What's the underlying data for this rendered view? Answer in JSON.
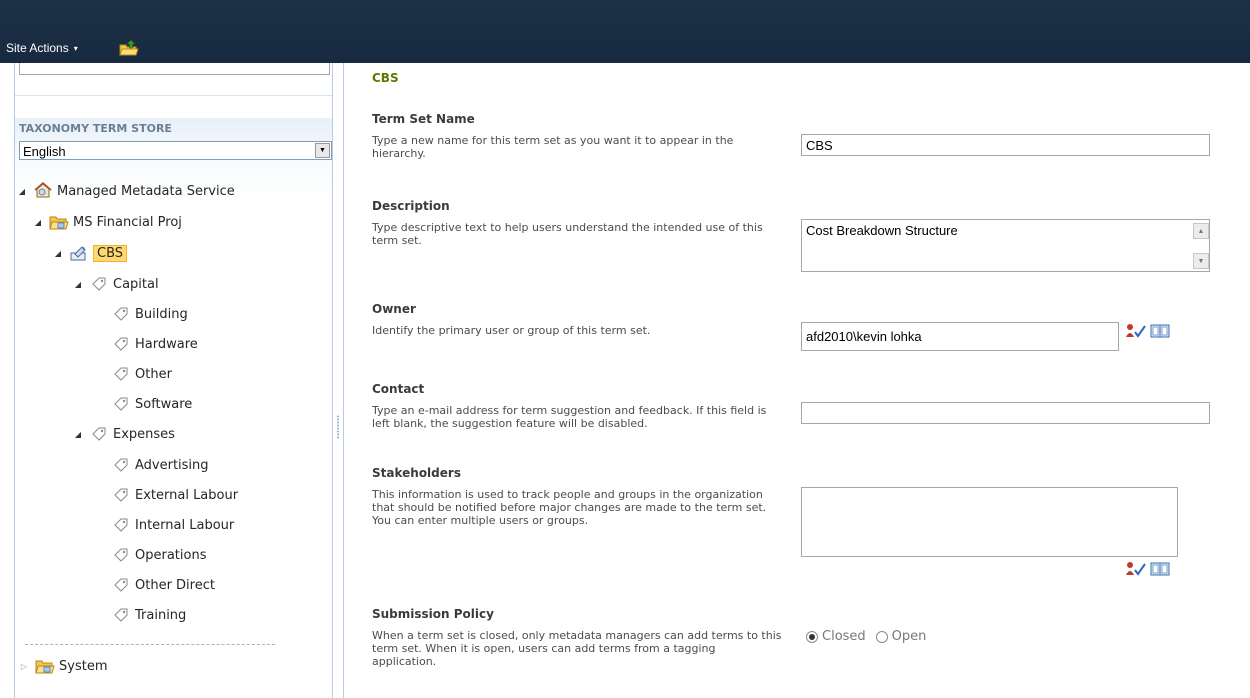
{
  "ribbon": {
    "site_actions_label": "Site Actions",
    "caret": "▾",
    "colors": {
      "background": "#1c3046",
      "text": "#ffffff"
    }
  },
  "left_pane": {
    "store_title": "TAXONOMY TERM STORE",
    "language": "English",
    "tree": {
      "root": "Managed Metadata Service",
      "group": "MS Financial Proj",
      "term_set": "CBS",
      "capital": "Capital",
      "capital_terms": [
        "Building",
        "Hardware",
        "Other",
        "Software"
      ],
      "expenses": "Expenses",
      "expense_terms": [
        "Advertising",
        "External Labour",
        "Internal Labour",
        "Operations",
        "Other Direct",
        "Training"
      ],
      "system": "System"
    },
    "selected_color": "#ffd96e"
  },
  "form": {
    "heading": "CBS",
    "term_set_name": {
      "title": "Term Set Name",
      "desc": "Type a new name for this term set as you want it to appear in the hierarchy.",
      "value": "CBS"
    },
    "description": {
      "title": "Description",
      "desc": "Type descriptive text to help users understand the intended use of this term set.",
      "value": "Cost Breakdown Structure"
    },
    "owner": {
      "title": "Owner",
      "desc": "Identify the primary user or group of this term set.",
      "value": "afd2010\\kevin lohka"
    },
    "contact": {
      "title": "Contact",
      "desc": "Type an e-mail address for term suggestion and feedback. If this field is left blank, the suggestion feature will be disabled.",
      "value": ""
    },
    "stakeholders": {
      "title": "Stakeholders",
      "desc": "This information is used to track people and groups in the organization that should be notified before major changes are made to the term set. You can enter multiple users or groups.",
      "value": ""
    },
    "submission_policy": {
      "title": "Submission Policy",
      "desc": "When a term set is closed, only metadata managers can add terms to this term set. When it is open, users can add terms from a tagging application.",
      "options": [
        "Closed",
        "Open"
      ],
      "selected": "Closed"
    },
    "colors": {
      "heading": "#5c7a00",
      "label": "#3b3b3b"
    }
  }
}
